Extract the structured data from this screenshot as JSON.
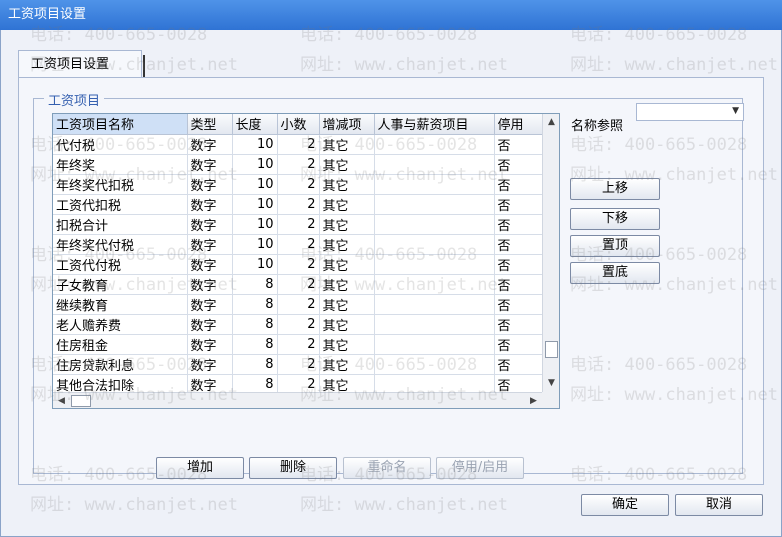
{
  "window": {
    "title": "工资项目设置"
  },
  "tabs": [
    {
      "label": "工资项目设置"
    }
  ],
  "group": {
    "title": "工资项目"
  },
  "table": {
    "columns": [
      "工资项目名称",
      "类型",
      "长度",
      "小数",
      "增减项",
      "人事与薪资项目",
      "停用"
    ],
    "rows": [
      [
        "代付税",
        "数字",
        "10",
        "2",
        "其它",
        "",
        "否"
      ],
      [
        "年终奖",
        "数字",
        "10",
        "2",
        "其它",
        "",
        "否"
      ],
      [
        "年终奖代扣税",
        "数字",
        "10",
        "2",
        "其它",
        "",
        "否"
      ],
      [
        "工资代扣税",
        "数字",
        "10",
        "2",
        "其它",
        "",
        "否"
      ],
      [
        "扣税合计",
        "数字",
        "10",
        "2",
        "其它",
        "",
        "否"
      ],
      [
        "年终奖代付税",
        "数字",
        "10",
        "2",
        "其它",
        "",
        "否"
      ],
      [
        "工资代付税",
        "数字",
        "10",
        "2",
        "其它",
        "",
        "否"
      ],
      [
        "子女教育",
        "数字",
        "8",
        "2",
        "其它",
        "",
        "否"
      ],
      [
        "继续教育",
        "数字",
        "8",
        "2",
        "其它",
        "",
        "否"
      ],
      [
        "老人赡养费",
        "数字",
        "8",
        "2",
        "其它",
        "",
        "否"
      ],
      [
        "住房租金",
        "数字",
        "8",
        "2",
        "其它",
        "",
        "否"
      ],
      [
        "住房贷款利息",
        "数字",
        "8",
        "2",
        "其它",
        "",
        "否"
      ],
      [
        "其他合法扣除",
        "数字",
        "8",
        "2",
        "其它",
        "",
        "否"
      ]
    ]
  },
  "reference": {
    "label": "名称参照",
    "value": ""
  },
  "side_buttons": {
    "move_up": "上移",
    "move_down": "下移",
    "to_top": "置顶",
    "to_bottom": "置底"
  },
  "bottom_buttons": {
    "add": "增加",
    "delete": "删除",
    "rename": "重命名",
    "toggle": "停用/启用"
  },
  "dialog_buttons": {
    "ok": "确定",
    "cancel": "取消"
  },
  "watermark": {
    "phone": "电话: 400-665-0028",
    "site": "网址: www.chanjet.net"
  }
}
